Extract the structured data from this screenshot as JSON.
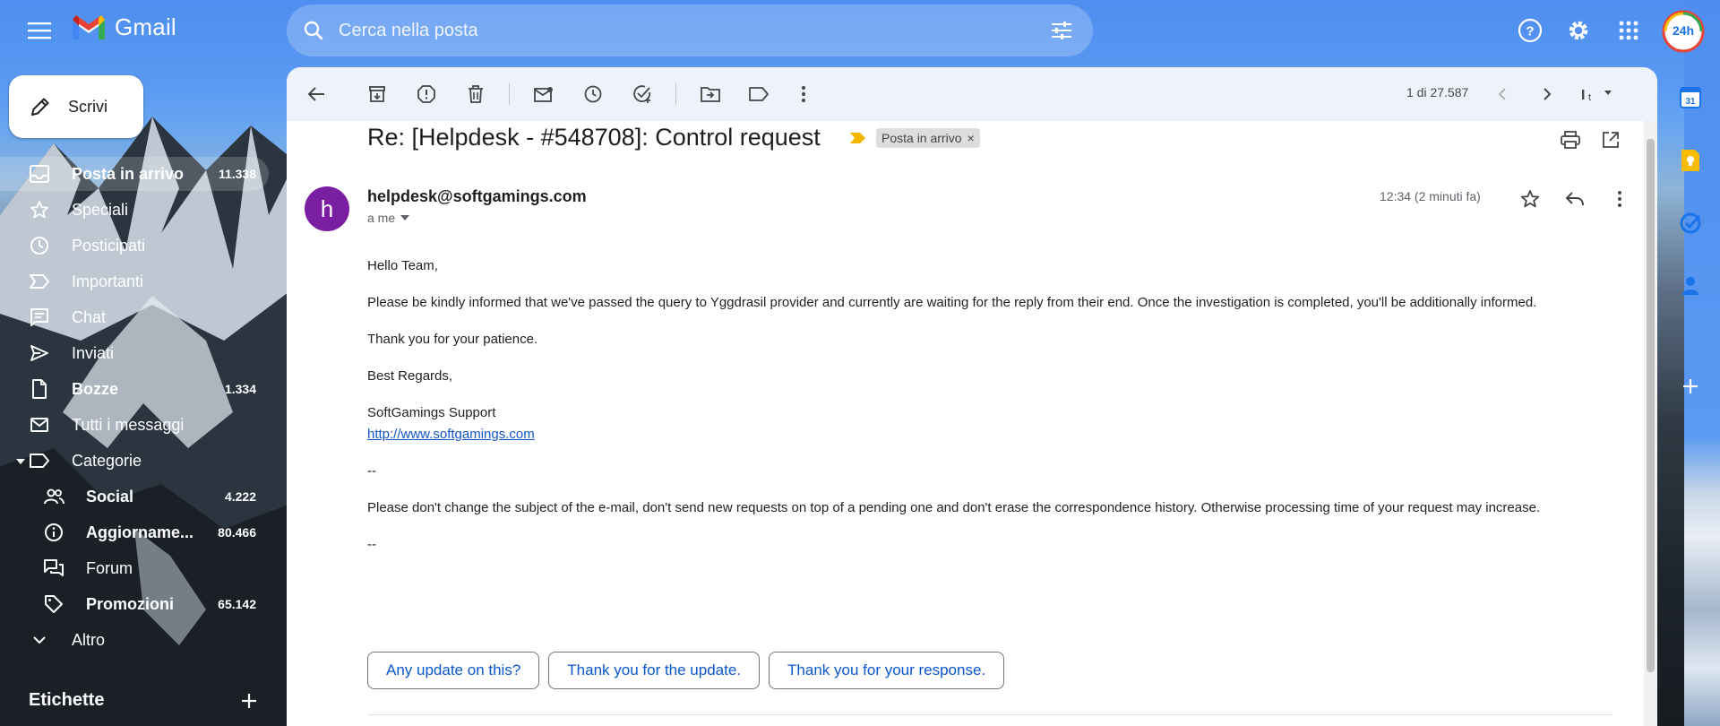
{
  "app": {
    "name": "Gmail"
  },
  "search": {
    "placeholder": "Cerca nella posta"
  },
  "compose": {
    "label": "Scrivi"
  },
  "sidebar": {
    "items": [
      {
        "label": "Posta in arrivo",
        "count": "11.338"
      },
      {
        "label": "Speciali",
        "count": ""
      },
      {
        "label": "Posticipati",
        "count": ""
      },
      {
        "label": "Importanti",
        "count": ""
      },
      {
        "label": "Chat",
        "count": ""
      },
      {
        "label": "Inviati",
        "count": ""
      },
      {
        "label": "Bozze",
        "count": "1.334"
      },
      {
        "label": "Tutti i messaggi",
        "count": ""
      },
      {
        "label": "Categorie",
        "count": ""
      },
      {
        "label": "Social",
        "count": "4.222"
      },
      {
        "label": "Aggiorname...",
        "count": "80.466"
      },
      {
        "label": "Forum",
        "count": ""
      },
      {
        "label": "Promozioni",
        "count": "65.142"
      },
      {
        "label": "Altro",
        "count": ""
      }
    ],
    "labels_heading": "Etichette"
  },
  "toolbar": {
    "pager": "1 di 27.587"
  },
  "email": {
    "subject": "Re: [Helpdesk - #548708]: Control request",
    "label_chip": "Posta in arrivo",
    "avatar_letter": "h",
    "sender": "helpdesk@softgamings.com",
    "to": "a me",
    "time": "12:34 (2 minuti fa)",
    "body": {
      "greeting": "Hello Team,",
      "p1": "Please be kindly informed that we've passed the query to Yggdrasil provider and currently are waiting for the reply from their end. Once the investigation is completed, you'll be additionally informed.",
      "p2": "Thank you for your patience.",
      "p3": "Best Regards,",
      "sig_name": "SoftGamings Support",
      "sig_link": "http://www.softgamings.com",
      "sep1": "--",
      "p4": "Please don't change the subject of the e-mail, don't send new requests on top of a pending one and don't erase the correspondence history. Otherwise processing time of your request may increase.",
      "sep2": "--"
    }
  },
  "smart_replies": [
    "Any update on this?",
    "Thank you for the update.",
    "Thank you for your response."
  ],
  "colors": {
    "accent": "#0b57d0",
    "avatar": "#7b1fa2",
    "important": "#f2b600"
  }
}
